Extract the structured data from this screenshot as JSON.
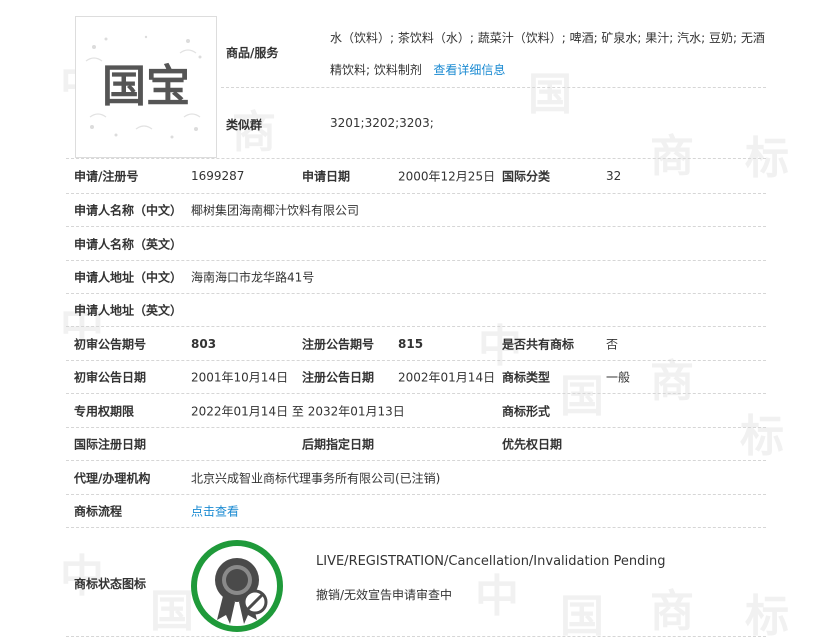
{
  "logo": {
    "text": "国宝"
  },
  "goods": {
    "label": "商品/服务",
    "value": "水（饮料）; 茶饮料（水）; 蔬菜汁（饮料）; 啤酒; 矿泉水; 果汁; 汽水; 豆奶; 无酒精饮料; 饮料制剂",
    "link": "查看详细信息"
  },
  "similar": {
    "label": "类似群",
    "value": "3201;3202;3203;"
  },
  "rows": {
    "reg_no_label": "申请/注册号",
    "reg_no": "1699287",
    "app_date_label": "申请日期",
    "app_date": "2000年12月25日",
    "intl_class_label": "国际分类",
    "intl_class": "32",
    "name_cn_label": "申请人名称（中文）",
    "name_cn": "椰树集团海南椰汁饮料有限公司",
    "name_en_label": "申请人名称（英文）",
    "addr_cn_label": "申请人地址（中文）",
    "addr_cn": "海南海口市龙华路41号",
    "addr_en_label": "申请人地址（英文）",
    "prelim_no_label": "初审公告期号",
    "prelim_no": "803",
    "reg_pub_no_label": "注册公告期号",
    "reg_pub_no": "815",
    "shared_label": "是否共有商标",
    "shared": "否",
    "prelim_date_label": "初审公告日期",
    "prelim_date": "2001年10月14日",
    "reg_pub_date_label": "注册公告日期",
    "reg_pub_date": "2002年01月14日",
    "tm_type_label": "商标类型",
    "tm_type": "一般",
    "exclusive_label": "专用权期限",
    "exclusive": "2022年01月14日 至 2032年01月13日",
    "tm_form_label": "商标形式",
    "intl_reg_date_label": "国际注册日期",
    "later_date_label": "后期指定日期",
    "priority_date_label": "优先权日期",
    "agent_label": "代理/办理机构",
    "agent": "北京兴成智业商标代理事务所有限公司(已注销)",
    "flow_label": "商标流程",
    "flow_link": "点击查看"
  },
  "status": {
    "label": "商标状态图标",
    "en": "LIVE/REGISTRATION/Cancellation/Invalidation Pending",
    "cn": "撤销/无效宣告申请审查中",
    "ring_color": "#1f9a3a",
    "icon": "award-ribbon-prohibited-icon"
  },
  "watermark": {
    "chars": [
      "中",
      "国",
      "商",
      "标"
    ]
  }
}
